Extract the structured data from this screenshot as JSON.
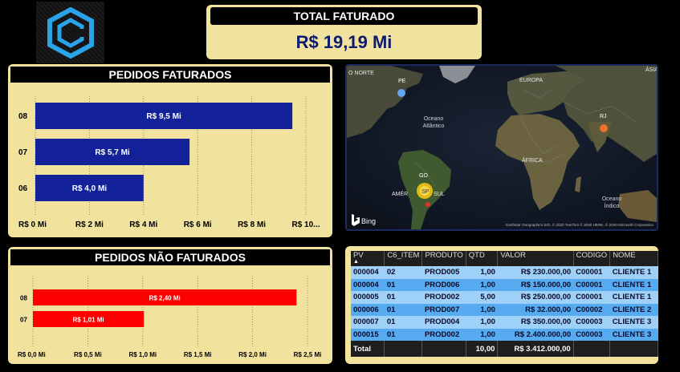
{
  "kpi": {
    "title": "TOTAL FATURADO",
    "value": "R$ 19,19 Mi"
  },
  "charts": {
    "faturados": {
      "title": "PEDIDOS FATURADOS"
    },
    "nao_faturados": {
      "title": "PEDIDOS NÃO FATURADOS"
    }
  },
  "chart_data": [
    {
      "type": "bar",
      "title": "PEDIDOS FATURADOS",
      "orientation": "horizontal",
      "categories": [
        "08",
        "07",
        "06"
      ],
      "values": [
        9.5,
        5.7,
        4.0
      ],
      "data_labels": [
        "R$ 9,5 Mi",
        "R$ 5,7 Mi",
        "R$ 4,0 Mi"
      ],
      "xlim": [
        0,
        10
      ],
      "xticks": [
        "R$ 0 Mi",
        "R$ 2 Mi",
        "R$ 4 Mi",
        "R$ 6 Mi",
        "R$ 8 Mi",
        "R$ 10..."
      ],
      "color": "#14229a",
      "grid": "vertical dotted"
    },
    {
      "type": "bar",
      "title": "PEDIDOS NÃO FATURADOS",
      "orientation": "horizontal",
      "categories": [
        "08",
        "07"
      ],
      "values": [
        2.4,
        1.01
      ],
      "data_labels": [
        "R$ 2,40 Mi",
        "R$ 1,01 Mi"
      ],
      "xlim": [
        0,
        2.5
      ],
      "xticks": [
        "R$ 0,0 Mi",
        "R$ 0,5 Mi",
        "R$ 1,0 Mi",
        "R$ 1,5 Mi",
        "R$ 2,0 Mi",
        "R$ 2,5 Mi"
      ],
      "color": "#ff0000",
      "grid": "vertical dotted"
    }
  ],
  "map": {
    "labels": {
      "north": "O NORTE",
      "europe": "EUROPA",
      "asia": "ÁSIA",
      "atlantic": "Oceano\nAtlântico",
      "africa": "ÁFRICA",
      "indian": "Oceano\nÍndico",
      "america_left": "AMÉR",
      "america_right": "SUL"
    },
    "markers": [
      "PE",
      "RJ",
      "GO",
      "SP"
    ],
    "bing": "Bing",
    "credits": "Earthstar Geographics SIO, © 2020 TomTom © 2020 HERE, © 2020 Microsoft Corporation"
  },
  "table": {
    "columns": [
      "PV",
      "C6_ITEM",
      "PRODUTO",
      "QTD",
      "VALOR",
      "CODIGO",
      "NOME"
    ],
    "rows": [
      [
        "000004",
        "02",
        "PROD005",
        "1,00",
        "R$ 230.000,00",
        "C00001",
        "CLIENTE 1"
      ],
      [
        "000004",
        "01",
        "PROD006",
        "1,00",
        "R$ 150.000,00",
        "C00001",
        "CLIENTE 1"
      ],
      [
        "000005",
        "01",
        "PROD002",
        "5,00",
        "R$ 250.000,00",
        "C00001",
        "CLIENTE 1"
      ],
      [
        "000006",
        "01",
        "PROD007",
        "1,00",
        "R$ 32.000,00",
        "C00002",
        "CLIENTE 2"
      ],
      [
        "000007",
        "01",
        "PROD004",
        "1,00",
        "R$ 350.000,00",
        "C00003",
        "CLIENTE 3"
      ],
      [
        "000015",
        "01",
        "PROD002",
        "1,00",
        "R$ 2.400.000,00",
        "C00003",
        "CLIENTE 3"
      ]
    ],
    "total": {
      "label": "Total",
      "qtd": "10,00",
      "valor": "R$ 3.412.000,00"
    }
  }
}
